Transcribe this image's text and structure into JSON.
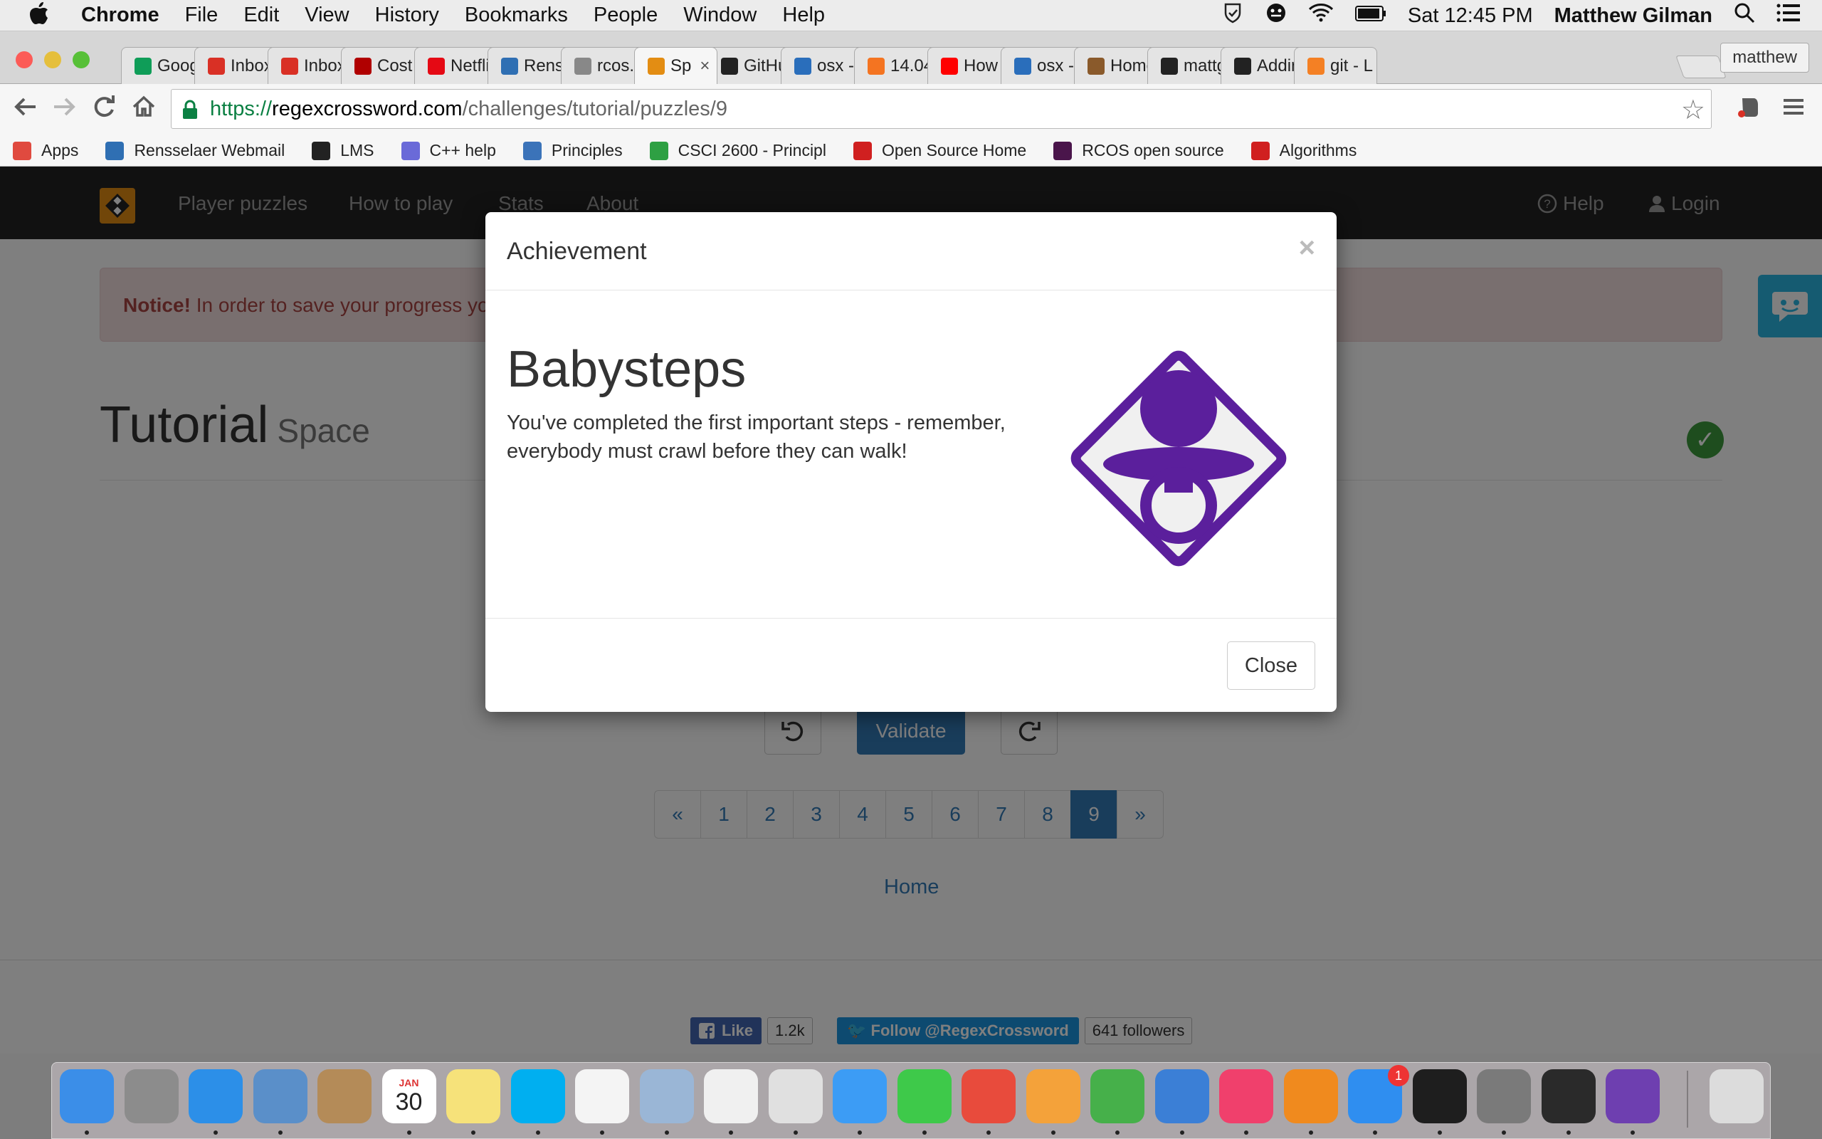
{
  "menubar": {
    "app_name": "Chrome",
    "menus": [
      "File",
      "Edit",
      "View",
      "History",
      "Bookmarks",
      "People",
      "Window",
      "Help"
    ],
    "clock": "Sat 12:45 PM",
    "user": "Matthew Gilman"
  },
  "tabs": [
    {
      "label": "Goog",
      "icon": "sheets-icon",
      "color": "#0f9d58"
    },
    {
      "label": "Inbox",
      "icon": "gmail-icon",
      "color": "#d93025"
    },
    {
      "label": "Inbox",
      "icon": "gmail-icon",
      "color": "#d93025"
    },
    {
      "label": "Cost",
      "icon": "rpi-shield-icon",
      "color": "#b00000"
    },
    {
      "label": "Netflix",
      "icon": "netflix-icon",
      "color": "#e50914"
    },
    {
      "label": "Renss",
      "icon": "rensselaer-icon",
      "color": "#2f6fb3"
    },
    {
      "label": "rcos.g",
      "icon": "document-icon",
      "color": "#888888"
    },
    {
      "label": "Sp",
      "icon": "regexcrossword-icon",
      "color": "#e38d13",
      "active": true
    },
    {
      "label": "GitHu",
      "icon": "github-icon",
      "color": "#222222"
    },
    {
      "label": "osx -",
      "icon": "superuser-icon",
      "color": "#2a6ebb"
    },
    {
      "label": "14.04",
      "icon": "askubuntu-icon",
      "color": "#f47421"
    },
    {
      "label": "How",
      "icon": "youtube-icon",
      "color": "#ff0000"
    },
    {
      "label": "osx -",
      "icon": "superuser-icon",
      "color": "#2a6ebb"
    },
    {
      "label": "Home",
      "icon": "home-icon",
      "color": "#8a5a2b"
    },
    {
      "label": "mattg",
      "icon": "github-icon",
      "color": "#222222"
    },
    {
      "label": "Addin",
      "icon": "github-icon",
      "color": "#222222"
    },
    {
      "label": "git - L",
      "icon": "stackoverflow-icon",
      "color": "#f48024"
    }
  ],
  "profile_button": "matthew",
  "address": {
    "scheme": "https://",
    "host": "regexcrossword.com",
    "path": "/challenges/tutorial/puzzles/9"
  },
  "bookmarks": [
    {
      "label": "Apps",
      "icon": "apps-grid-icon",
      "color": "#e04a3f"
    },
    {
      "label": "Rensselaer Webmail",
      "icon": "webmail-icon",
      "color": "#2f6fb3"
    },
    {
      "label": "LMS",
      "icon": "blackboard-icon",
      "color": "#222222"
    },
    {
      "label": "C++ help",
      "icon": "cplusplus-icon",
      "color": "#6a6ad8"
    },
    {
      "label": "Principles",
      "icon": "principles-icon",
      "color": "#3b73b9"
    },
    {
      "label": "CSCI 2600 - Principl",
      "icon": "refresh-green-icon",
      "color": "#2ea043"
    },
    {
      "label": "Open Source Home",
      "icon": "cs-icon",
      "color": "#d02020"
    },
    {
      "label": "RCOS open source",
      "icon": "slack-hash-icon",
      "color": "#4a154b"
    },
    {
      "label": "Algorithms",
      "icon": "cs-icon",
      "color": "#d02020"
    }
  ],
  "site": {
    "nav": [
      "Player puzzles",
      "How to play",
      "Stats",
      "About"
    ],
    "help": "Help",
    "login": "Login",
    "notice_strong": "Notice!",
    "notice_text": "In order to save your progress yo",
    "title": "Tutorial",
    "subtitle": "Space",
    "validate": "Validate",
    "pagination": [
      "«",
      "1",
      "2",
      "3",
      "4",
      "5",
      "6",
      "7",
      "8",
      "9",
      "»"
    ],
    "current_page": "9",
    "home": "Home",
    "fb_like": "Like",
    "fb_count": "1.2k",
    "tw_follow": "Follow @RegexCrossword",
    "tw_count": "641 followers"
  },
  "modal": {
    "title": "Achievement",
    "close_x": "×",
    "achievement_name": "Babysteps",
    "achievement_desc": "You've completed the first important steps - remember, everybody must crawl before they can walk!",
    "close_button": "Close",
    "badge_color": "#5b1f9c"
  },
  "dock": [
    {
      "name": "finder-icon",
      "color": "#3b8ee8"
    },
    {
      "name": "launchpad-icon",
      "color": "#8c8c8c"
    },
    {
      "name": "safari-icon",
      "color": "#2c8fe8"
    },
    {
      "name": "mail-icon",
      "color": "#5a8fc9"
    },
    {
      "name": "contacts-icon",
      "color": "#b48b58"
    },
    {
      "name": "calendar-icon",
      "color": "#ffffff",
      "text": "30",
      "caption": "JAN"
    },
    {
      "name": "notes-icon",
      "color": "#f6e27a"
    },
    {
      "name": "skype-icon",
      "color": "#00aff0"
    },
    {
      "name": "reminders-icon",
      "color": "#f4f4f4"
    },
    {
      "name": "preview-icon",
      "color": "#9ab6d6"
    },
    {
      "name": "photos-icon",
      "color": "#f0f0f0"
    },
    {
      "name": "chrome-icon",
      "color": "#e0e0e0"
    },
    {
      "name": "messages-icon",
      "color": "#3c9cf5"
    },
    {
      "name": "facetime-icon",
      "color": "#3ec94a"
    },
    {
      "name": "popcorn-icon",
      "color": "#e84b3c"
    },
    {
      "name": "pages-icon",
      "color": "#f4a23a"
    },
    {
      "name": "numbers-icon",
      "color": "#46b04a"
    },
    {
      "name": "keynote-icon",
      "color": "#3b7fd6"
    },
    {
      "name": "itunes-icon",
      "color": "#f0406c"
    },
    {
      "name": "ibooks-icon",
      "color": "#f08a1e"
    },
    {
      "name": "app-store-icon",
      "color": "#2f8ef0",
      "badge": "1"
    },
    {
      "name": "terminal-icon",
      "color": "#1e1e1e"
    },
    {
      "name": "system-preferences-icon",
      "color": "#7a7a7a"
    },
    {
      "name": "activity-monitor-icon",
      "color": "#2a2a2a"
    },
    {
      "name": "github-desktop-icon",
      "color": "#6e3fb0"
    },
    {
      "name": "trash-icon",
      "color": "#dcdcdc"
    }
  ]
}
